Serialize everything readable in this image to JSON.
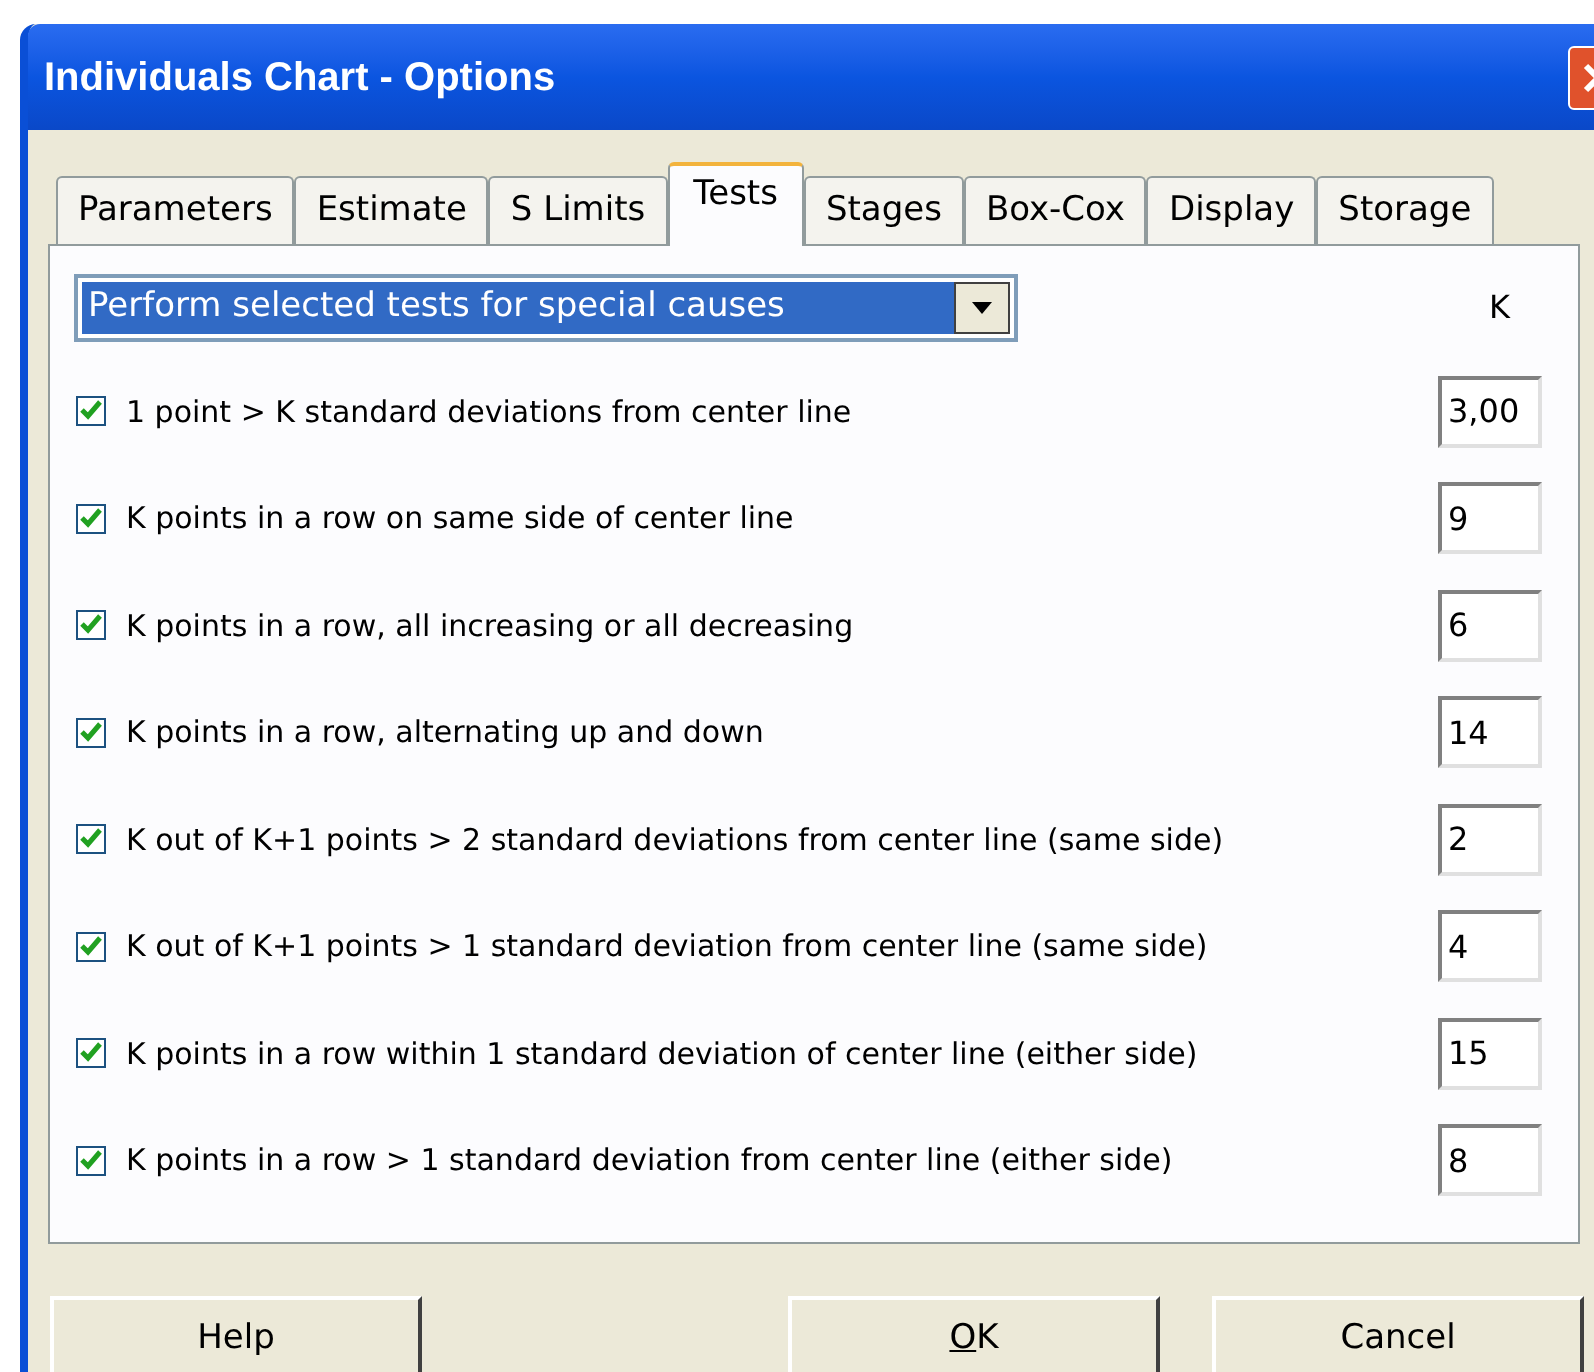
{
  "window": {
    "title": "Individuals Chart - Options"
  },
  "tabs": [
    {
      "label": "Parameters",
      "selected": false
    },
    {
      "label": "Estimate",
      "selected": false
    },
    {
      "label": "S Limits",
      "selected": false
    },
    {
      "label": "Tests",
      "selected": true
    },
    {
      "label": "Stages",
      "selected": false
    },
    {
      "label": "Box-Cox",
      "selected": false
    },
    {
      "label": "Display",
      "selected": false
    },
    {
      "label": "Storage",
      "selected": false
    }
  ],
  "test_mode": {
    "value": "Perform selected tests for special causes"
  },
  "k_header": "K",
  "tests": [
    {
      "label": "1 point > K standard deviations from center line",
      "checked": true,
      "k": "3,00"
    },
    {
      "label": "K points in a row on same side of center line",
      "checked": true,
      "k": "9"
    },
    {
      "label": "K points in a row, all increasing or all decreasing",
      "checked": true,
      "k": "6"
    },
    {
      "label": "K points in a row, alternating up and down",
      "checked": true,
      "k": "14"
    },
    {
      "label": "K out of K+1 points > 2 standard deviations from center line (same side)",
      "checked": true,
      "k": "2"
    },
    {
      "label": "K out of K+1 points > 1 standard deviation from center line (same side)",
      "checked": true,
      "k": "4"
    },
    {
      "label": "K points in a row within 1 standard deviation of center line (either side)",
      "checked": true,
      "k": "15"
    },
    {
      "label": "K points in a row > 1 standard deviation from center line (either side)",
      "checked": true,
      "k": "8"
    }
  ],
  "buttons": [
    {
      "label": "Help",
      "mnemonic": false
    },
    {
      "label": "OK",
      "mnemonic": true
    },
    {
      "label": "Cancel",
      "mnemonic": false
    }
  ]
}
